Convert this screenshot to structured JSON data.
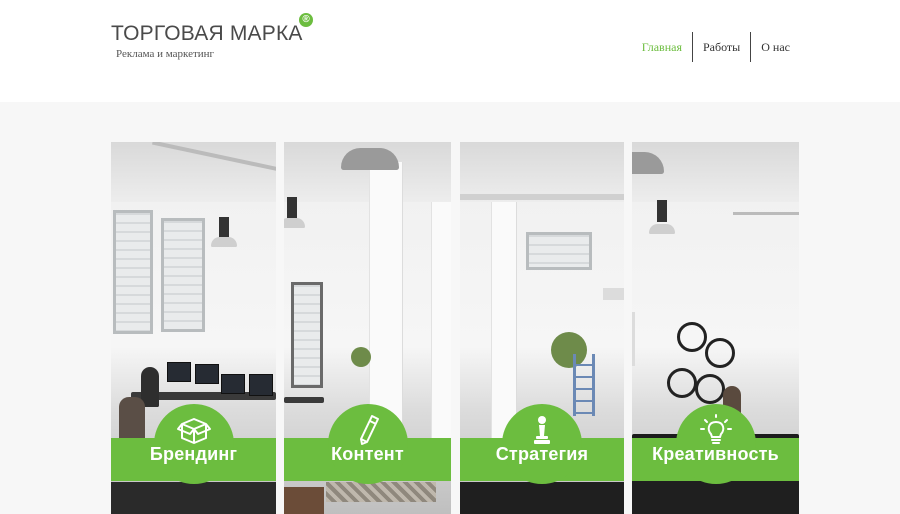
{
  "brand": {
    "title": "ТОРГОВАЯ МАРКА",
    "registered_mark": "®",
    "subtitle": "Реклама и маркетинг"
  },
  "nav": [
    {
      "label": "Главная",
      "active": true
    },
    {
      "label": "Работы",
      "active": false
    },
    {
      "label": "О нас",
      "active": false
    }
  ],
  "panels": [
    {
      "label": "Брендинг",
      "icon": "box-icon"
    },
    {
      "label": "Контент",
      "icon": "pencil-icon"
    },
    {
      "label": "Стратегия",
      "icon": "chess-pawn-icon"
    },
    {
      "label": "Креативность",
      "icon": "lightbulb-icon"
    }
  ],
  "colors": {
    "accent": "#6cbd3f",
    "header_bg": "#ffffff",
    "page_bg": "#f7f7f7",
    "text": "#4a4a4a"
  }
}
